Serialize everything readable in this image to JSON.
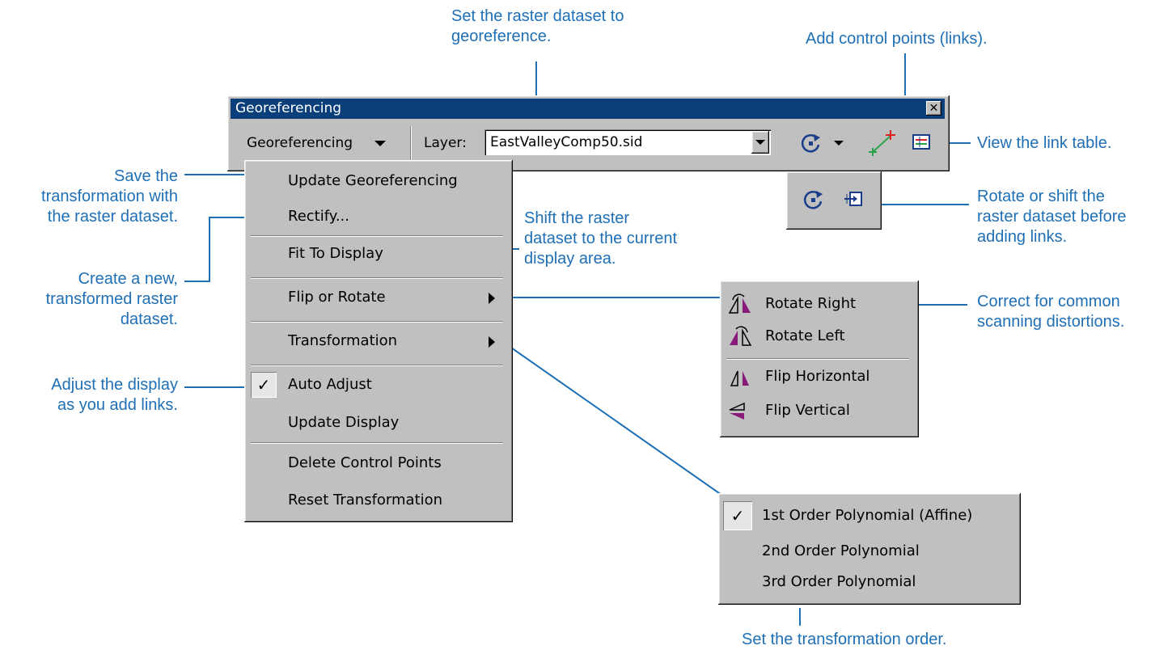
{
  "callouts": {
    "set_raster": "Set the raster dataset to\ngeoreference.",
    "add_control_points": "Add control points (links).",
    "view_link_table": "View the link table.",
    "save_transformation": "Save the\ntransformation with\nthe raster dataset.",
    "create_new": "Create a new,\ntransformed raster\ndataset.",
    "shift_raster": "Shift the raster\ndataset to the current\ndisplay area.",
    "rotate_or_shift": "Rotate or shift the\nraster dataset before\nadding links.",
    "correct_distortions": "Correct for common\nscanning distortions.",
    "adjust_display": "Adjust the display\nas you add links.",
    "set_order": "Set the transformation order."
  },
  "window": {
    "title": "Georeferencing"
  },
  "toolbar": {
    "menu_label": "Georeferencing",
    "layer_label": "Layer:",
    "layer_value": "EastValleyComp50.sid"
  },
  "menu": {
    "items": [
      {
        "label": "Update Georeferencing"
      },
      {
        "label": "Rectify..."
      },
      {
        "label": "Fit To Display"
      },
      {
        "label": "Flip or Rotate"
      },
      {
        "label": "Transformation"
      },
      {
        "label": "Auto Adjust",
        "checked": true
      },
      {
        "label": "Update Display"
      },
      {
        "label": "Delete Control Points"
      },
      {
        "label": "Reset Transformation"
      }
    ]
  },
  "flip_rotate_menu": {
    "items": [
      {
        "label": "Rotate Right",
        "icon": "rotate-right-icon"
      },
      {
        "label": "Rotate Left",
        "icon": "rotate-left-icon"
      },
      {
        "label": "Flip Horizontal",
        "icon": "flip-horizontal-icon"
      },
      {
        "label": "Flip Vertical",
        "icon": "flip-vertical-icon"
      }
    ]
  },
  "transformation_menu": {
    "items": [
      {
        "label": "1st Order Polynomial (Affine)",
        "checked": true
      },
      {
        "label": "2nd Order Polynomial"
      },
      {
        "label": "3rd Order Polynomial"
      }
    ]
  },
  "colors": {
    "callout": "#1f6fb5",
    "titlebar": "#0a3f7a",
    "face": "#c0c0c0",
    "icon_purple": "#8a1a7a"
  }
}
